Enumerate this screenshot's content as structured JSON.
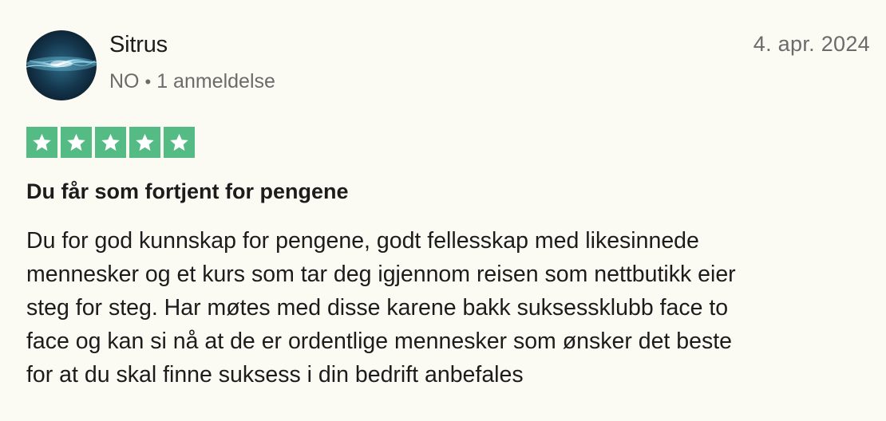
{
  "reviewer": {
    "name": "Sitrus",
    "country": "NO",
    "separator": "•",
    "review_count": "1 anmeldelse"
  },
  "review": {
    "date": "4. apr. 2024",
    "rating": 5,
    "rating_max": 5,
    "star_color": "#53bb83",
    "title": "Du får som fortjent for pengene",
    "body_lines": [
      "Du for god kunnskap for pengene, godt fellesskap med likesinnede",
      "mennesker og et kurs som tar deg igjennom reisen som nettbutikk eier",
      "steg for steg. Har møtes med disse karene bakk suksessklubb face to",
      "face og kan si nå at de er ordentlige mennesker som ønsker det beste",
      "for at du skal finne suksess i din bedrift anbefales"
    ]
  },
  "icons": {
    "avatar": "avatar-image",
    "star": "star-icon"
  }
}
